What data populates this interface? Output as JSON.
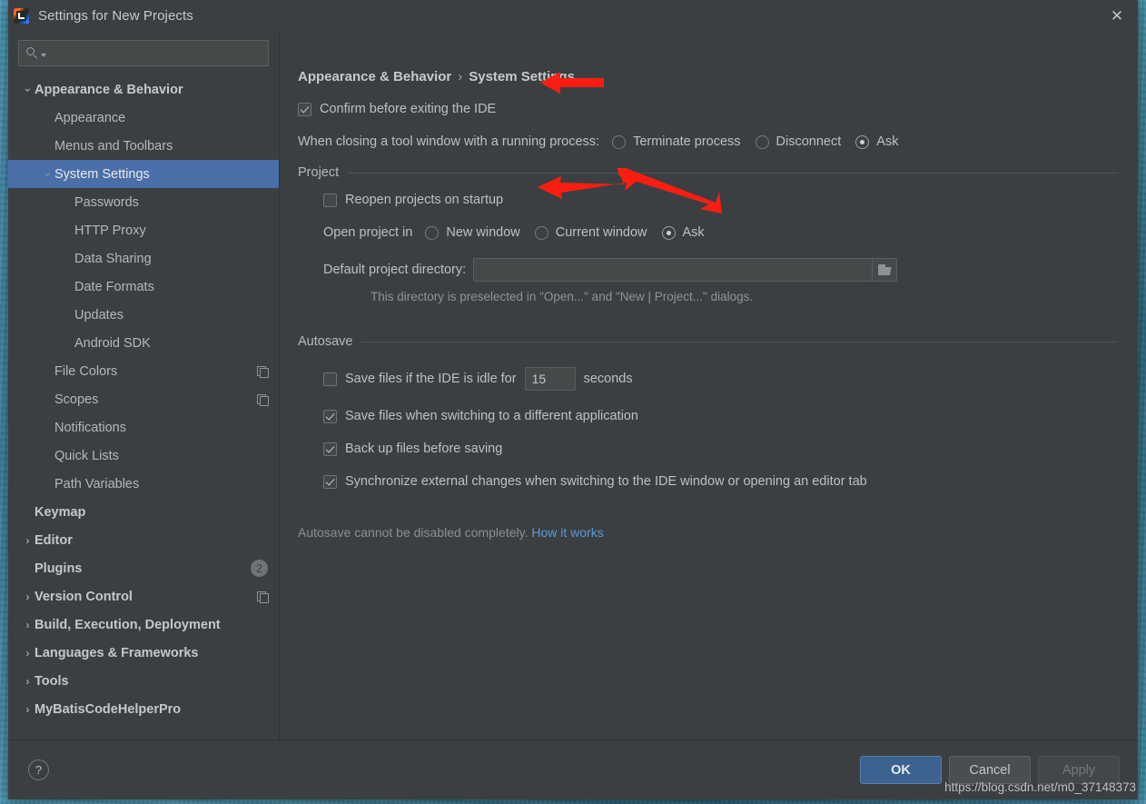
{
  "window": {
    "title": "Settings for New Projects",
    "app_icon": "intellij-idea-logo",
    "close_label": "✕"
  },
  "search": {
    "value": "",
    "placeholder": "",
    "icon": "search-icon"
  },
  "sidebar": {
    "items": [
      {
        "label": "Appearance & Behavior",
        "indent": 0,
        "arrow": "down",
        "bold": true,
        "selected": false,
        "trailing": ""
      },
      {
        "label": "Appearance",
        "indent": 1,
        "arrow": "",
        "bold": false,
        "selected": false,
        "trailing": ""
      },
      {
        "label": "Menus and Toolbars",
        "indent": 1,
        "arrow": "",
        "bold": false,
        "selected": false,
        "trailing": ""
      },
      {
        "label": "System Settings",
        "indent": 1,
        "arrow": "down",
        "bold": false,
        "selected": true,
        "trailing": ""
      },
      {
        "label": "Passwords",
        "indent": 2,
        "arrow": "",
        "bold": false,
        "selected": false,
        "trailing": ""
      },
      {
        "label": "HTTP Proxy",
        "indent": 2,
        "arrow": "",
        "bold": false,
        "selected": false,
        "trailing": ""
      },
      {
        "label": "Data Sharing",
        "indent": 2,
        "arrow": "",
        "bold": false,
        "selected": false,
        "trailing": ""
      },
      {
        "label": "Date Formats",
        "indent": 2,
        "arrow": "",
        "bold": false,
        "selected": false,
        "trailing": ""
      },
      {
        "label": "Updates",
        "indent": 2,
        "arrow": "",
        "bold": false,
        "selected": false,
        "trailing": ""
      },
      {
        "label": "Android SDK",
        "indent": 2,
        "arrow": "",
        "bold": false,
        "selected": false,
        "trailing": ""
      },
      {
        "label": "File Colors",
        "indent": 1,
        "arrow": "",
        "bold": false,
        "selected": false,
        "trailing": "copy"
      },
      {
        "label": "Scopes",
        "indent": 1,
        "arrow": "",
        "bold": false,
        "selected": false,
        "trailing": "copy"
      },
      {
        "label": "Notifications",
        "indent": 1,
        "arrow": "",
        "bold": false,
        "selected": false,
        "trailing": ""
      },
      {
        "label": "Quick Lists",
        "indent": 1,
        "arrow": "",
        "bold": false,
        "selected": false,
        "trailing": ""
      },
      {
        "label": "Path Variables",
        "indent": 1,
        "arrow": "",
        "bold": false,
        "selected": false,
        "trailing": ""
      },
      {
        "label": "Keymap",
        "indent": 0,
        "arrow": "",
        "bold": true,
        "selected": false,
        "trailing": ""
      },
      {
        "label": "Editor",
        "indent": 0,
        "arrow": "right",
        "bold": true,
        "selected": false,
        "trailing": ""
      },
      {
        "label": "Plugins",
        "indent": 0,
        "arrow": "",
        "bold": true,
        "selected": false,
        "trailing": "badge",
        "badge": "2"
      },
      {
        "label": "Version Control",
        "indent": 0,
        "arrow": "right",
        "bold": true,
        "selected": false,
        "trailing": "copy"
      },
      {
        "label": "Build, Execution, Deployment",
        "indent": 0,
        "arrow": "right",
        "bold": true,
        "selected": false,
        "trailing": ""
      },
      {
        "label": "Languages & Frameworks",
        "indent": 0,
        "arrow": "right",
        "bold": true,
        "selected": false,
        "trailing": ""
      },
      {
        "label": "Tools",
        "indent": 0,
        "arrow": "right",
        "bold": true,
        "selected": false,
        "trailing": ""
      },
      {
        "label": "MyBatisCodeHelperPro",
        "indent": 0,
        "arrow": "right",
        "bold": true,
        "selected": false,
        "trailing": ""
      }
    ]
  },
  "main": {
    "breadcrumb": {
      "root": "Appearance & Behavior",
      "separator": "›",
      "leaf": "System Settings"
    },
    "confirm_exit": {
      "label": "Confirm before exiting the IDE",
      "checked": true
    },
    "tool_window": {
      "label": "When closing a tool window with a running process:",
      "options": [
        {
          "label": "Terminate process",
          "selected": false
        },
        {
          "label": "Disconnect",
          "selected": false
        },
        {
          "label": "Ask",
          "selected": true
        }
      ]
    },
    "project_group": {
      "title": "Project",
      "reopen": {
        "label": "Reopen projects on startup",
        "checked": false
      },
      "open_in": {
        "label": "Open project in",
        "options": [
          {
            "label": "New window",
            "selected": false
          },
          {
            "label": "Current window",
            "selected": false
          },
          {
            "label": "Ask",
            "selected": true
          }
        ]
      },
      "default_dir": {
        "label": "Default project directory:",
        "value": "",
        "browse_icon": "folder-icon",
        "hint": "This directory is preselected in \"Open...\" and \"New | Project...\" dialogs."
      }
    },
    "autosave_group": {
      "title": "Autosave",
      "idle": {
        "label_before": "Save files if the IDE is idle for",
        "value": "15",
        "label_after": "seconds",
        "checked": false
      },
      "checkboxes": [
        {
          "label": "Save files when switching to a different application",
          "checked": true
        },
        {
          "label": "Back up files before saving",
          "checked": true
        },
        {
          "label": "Synchronize external changes when switching to the IDE window or opening an editor tab",
          "checked": true
        }
      ],
      "footnote_text": "Autosave cannot be disabled completely.",
      "footnote_link": "How it works"
    }
  },
  "footer": {
    "help_label": "?",
    "ok_label": "OK",
    "cancel_label": "Cancel",
    "apply_label": "Apply"
  },
  "watermark": "https://blog.csdn.net/m0_37148373",
  "colors": {
    "dialog_bg": "#3c3f41",
    "selection_blue": "#4a6fa8",
    "primary_button": "#3c628f",
    "link_blue": "#5b9ad9",
    "annotation_red": "#fc1d12"
  }
}
